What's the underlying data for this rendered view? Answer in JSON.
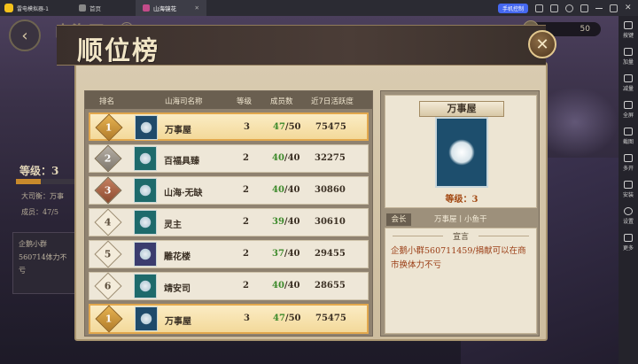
{
  "titlebar": {
    "app_name": "雷电模拟器-1",
    "tabs": [
      {
        "label": "首页"
      },
      {
        "label": "山海镜花"
      }
    ],
    "phone_control": "手机控制"
  },
  "sidebar": {
    "items": [
      {
        "label": "按键",
        "icon": "keyboard-icon"
      },
      {
        "label": "加量",
        "icon": "volume-up-icon"
      },
      {
        "label": "减量",
        "icon": "volume-down-icon"
      },
      {
        "label": "全屏",
        "icon": "fullscreen-icon"
      },
      {
        "label": "截图",
        "icon": "scissors-icon"
      },
      {
        "label": "多开",
        "icon": "multi-instance-icon"
      },
      {
        "label": "安装",
        "icon": "apk-install-icon"
      },
      {
        "label": "设置",
        "icon": "gear-icon"
      },
      {
        "label": "更多",
        "icon": "more-icon"
      }
    ]
  },
  "game": {
    "bg_title": "山海司",
    "currency_value": "50",
    "left_panel": {
      "level_label": "等级：3",
      "line1": "大司衡：万事",
      "line2": "成员：47/5",
      "notice": "企鹅小群560714体力不亏"
    }
  },
  "dialog": {
    "title": "顺位榜",
    "columns": {
      "rank": "排名",
      "name": "山海司名称",
      "level": "等级",
      "members": "成员数",
      "active": "近7日活跃度"
    },
    "rows": [
      {
        "rank": "1",
        "name": "万事屋",
        "level": "3",
        "members_cur": "47",
        "members_max": "/50",
        "active": "75475"
      },
      {
        "rank": "2",
        "name": "百福具臻",
        "level": "2",
        "members_cur": "40",
        "members_max": "/40",
        "active": "32275"
      },
      {
        "rank": "3",
        "name": "山海·无缺",
        "level": "2",
        "members_cur": "40",
        "members_max": "/40",
        "active": "30860"
      },
      {
        "rank": "4",
        "name": "灵主",
        "level": "2",
        "members_cur": "39",
        "members_max": "/40",
        "active": "30610"
      },
      {
        "rank": "5",
        "name": "雕花楼",
        "level": "2",
        "members_cur": "37",
        "members_max": "/40",
        "active": "29455"
      },
      {
        "rank": "6",
        "name": "靖安司",
        "level": "2",
        "members_cur": "40",
        "members_max": "/40",
        "active": "28655"
      }
    ],
    "own_row": {
      "rank": "1",
      "name": "万事屋",
      "level": "3",
      "members_cur": "47",
      "members_max": "/50",
      "active": "75475"
    },
    "detail": {
      "name": "万事屋",
      "level": "等级：3",
      "leader_label": "会长",
      "leader_value": "万事屋丨小鱼干",
      "declaration_title": "宣言",
      "declaration_text": "企鹅小群560711459/捐献可以在商市换体力不亏"
    }
  }
}
